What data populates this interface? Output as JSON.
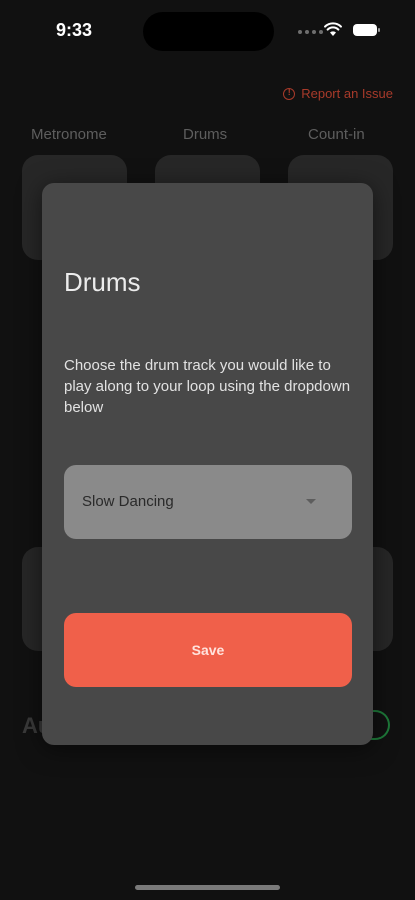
{
  "status_bar": {
    "time": "9:33"
  },
  "report_issue": {
    "label": "Report an Issue",
    "icon": "alert-circle-icon",
    "color": "#a83a2a"
  },
  "tabs": [
    {
      "label": "Metronome"
    },
    {
      "label": "Drums"
    },
    {
      "label": "Count-in"
    }
  ],
  "background": {
    "section_label": "Au"
  },
  "modal": {
    "title": "Drums",
    "description": "Choose the drum track you would like to play along to your loop using the dropdown below",
    "dropdown": {
      "selected": "Slow Dancing",
      "icon": "caret-down-icon"
    },
    "save_label": "Save"
  },
  "colors": {
    "accent": "#f0604a",
    "modal_bg": "#484848",
    "page_bg": "#111111"
  }
}
